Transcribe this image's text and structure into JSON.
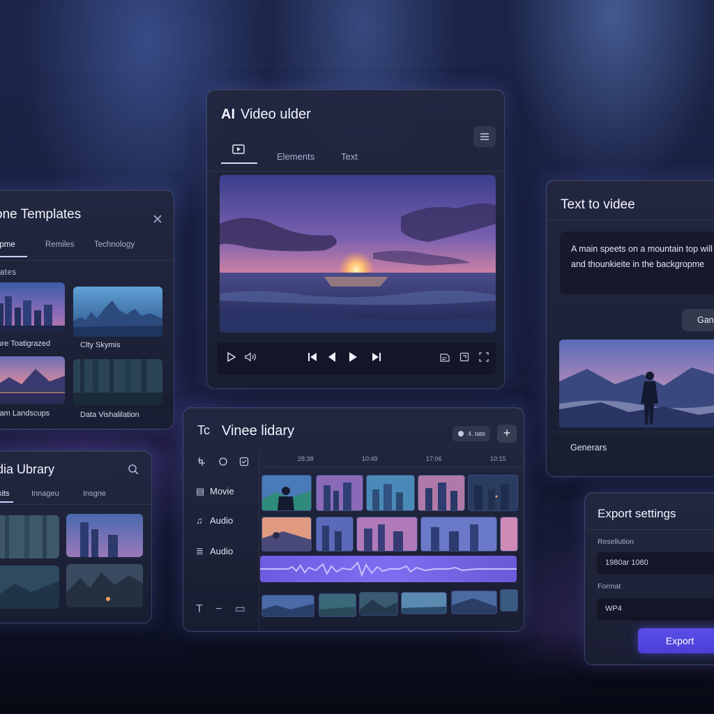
{
  "colors": {
    "accent": "#4f44dc",
    "audio_wave": "#7d6ef0",
    "panel_border": "#8ca0ff"
  },
  "templates_panel": {
    "title": "one Templates",
    "tabs": [
      {
        "label": "opme"
      },
      {
        "label": "Remiles"
      },
      {
        "label": "Technology"
      }
    ],
    "section_label": "eates",
    "items": [
      {
        "caption": "sure Toatigrazed"
      },
      {
        "caption": "Clty Skymis"
      },
      {
        "caption": "stam Landscups"
      },
      {
        "caption": "Data Vishalilation"
      }
    ]
  },
  "media_panel": {
    "title": "dia Ubrary",
    "tabs": [
      {
        "label": "kits"
      },
      {
        "label": "Innageu"
      },
      {
        "label": "Insgne"
      }
    ]
  },
  "main_panel": {
    "title_prefix": "AI",
    "title": "Video ulder",
    "tabs": [
      {
        "label": "Elements"
      },
      {
        "label": "Text"
      }
    ]
  },
  "text_panel": {
    "title": "Text to videe",
    "prompt": "A main speets on a mountain top will iske and thounkieite in the backgropme",
    "generate_button": "Gana",
    "footer_label": "Generars"
  },
  "timeline_panel": {
    "title_icon": "Tc",
    "title": "Vinee lidary",
    "pill_label": "4. tate",
    "ruler": [
      "28:38",
      "10:49",
      "17:06",
      "10:15"
    ],
    "tracks": [
      {
        "label": "Movie"
      },
      {
        "label": "Audio"
      },
      {
        "label": "Audio"
      }
    ]
  },
  "export_panel": {
    "title": "Export settings",
    "resolution_label": "Resellution",
    "resolution_value": "1980ar 1080",
    "format_label": "Format",
    "format_value": "WP4",
    "export_button": "Export"
  }
}
